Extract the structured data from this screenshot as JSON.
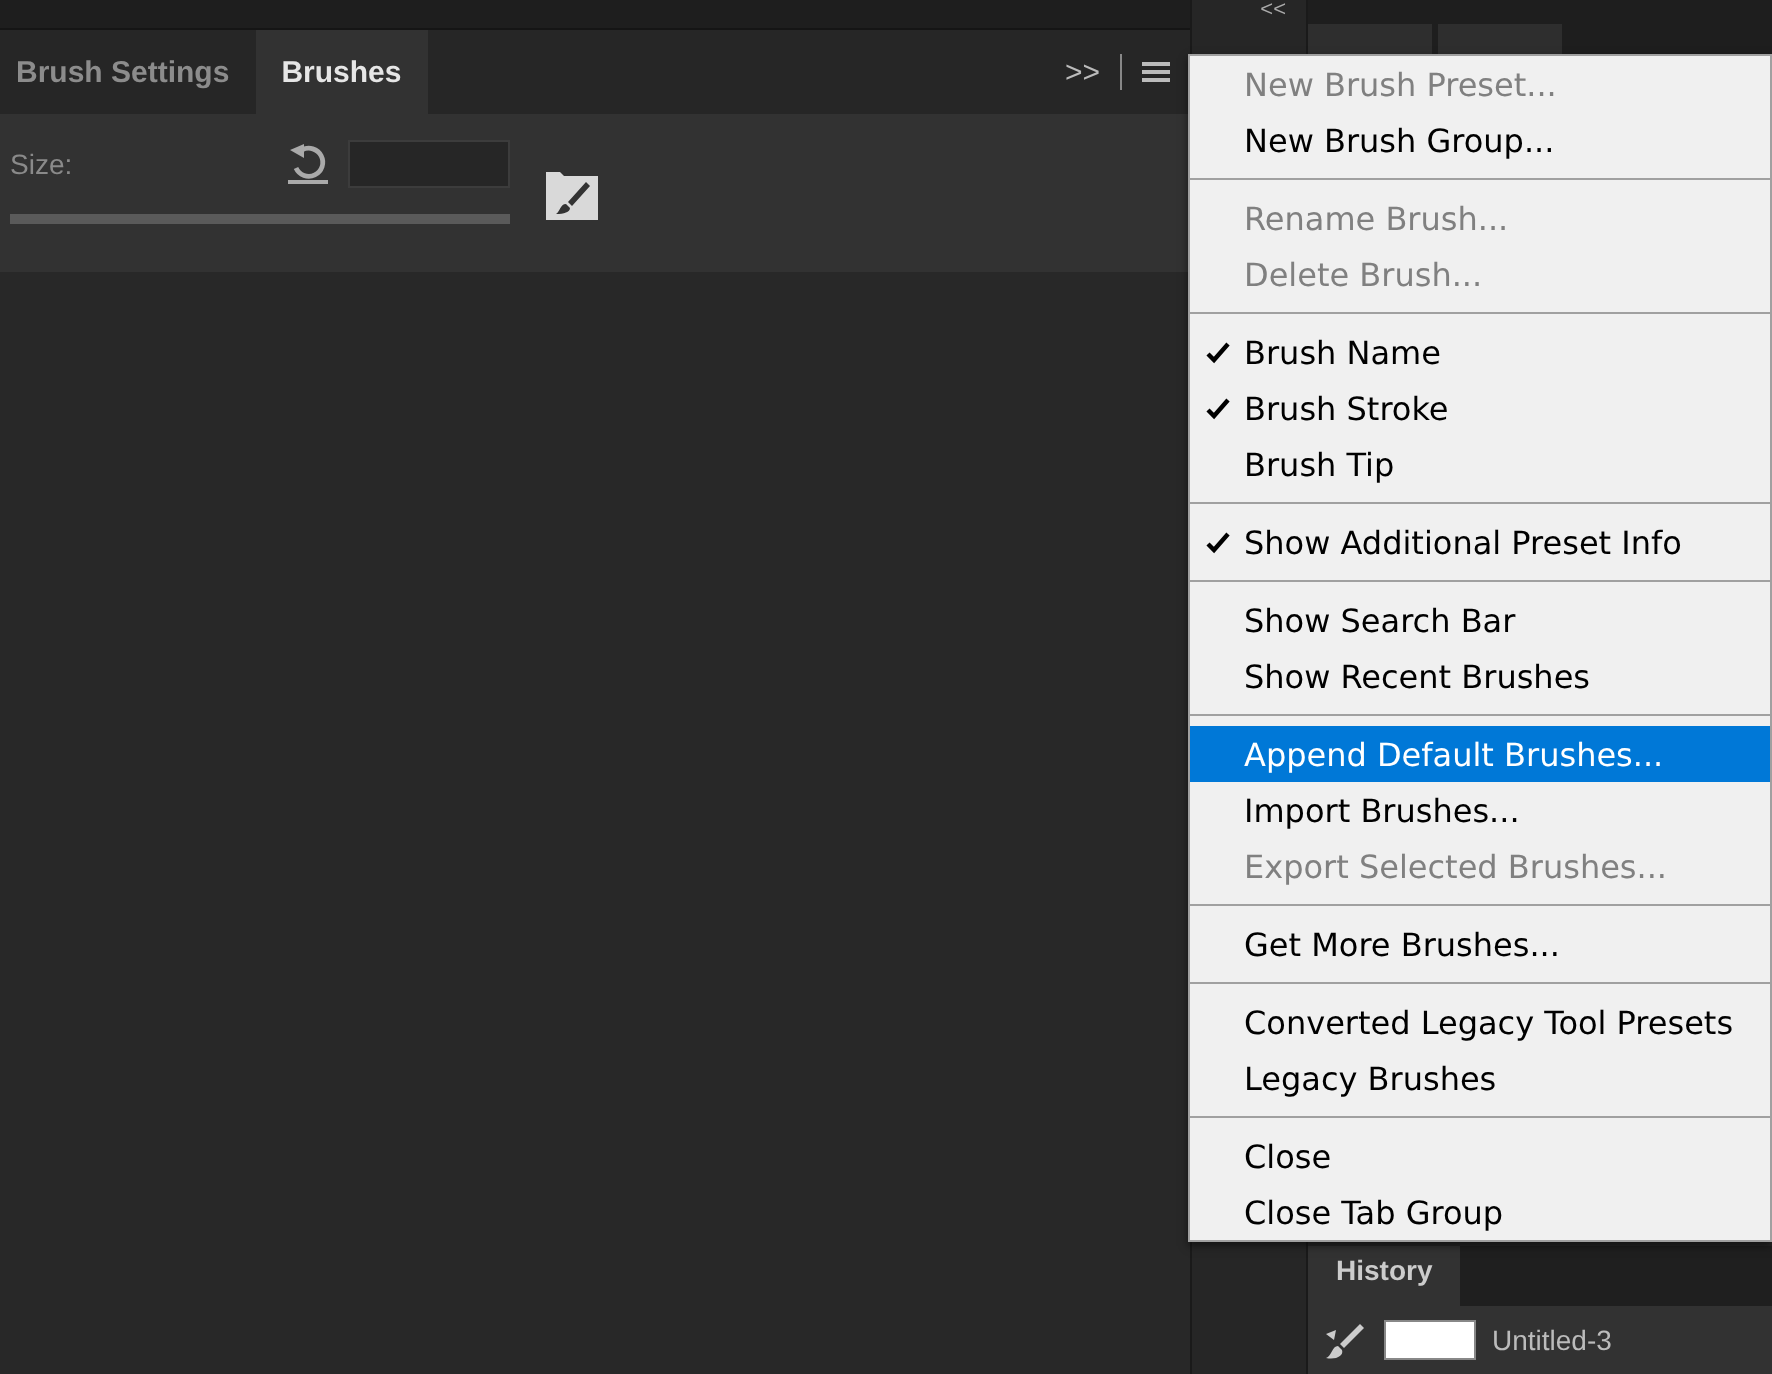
{
  "panel": {
    "tabs": [
      {
        "label": "Brush Settings",
        "selected": false
      },
      {
        "label": "Brushes",
        "selected": true
      }
    ],
    "expand_label": ">>",
    "size_label": "Size:",
    "size_slider": {
      "level": 1
    }
  },
  "dock": {
    "collapse_label": "<<",
    "history_tab": "History",
    "history_item": "Untitled-3"
  },
  "menu": {
    "groups": [
      [
        {
          "label": "New Brush Preset...",
          "disabled": true,
          "checked": false,
          "selected": false
        },
        {
          "label": "New Brush Group...",
          "disabled": false,
          "checked": false,
          "selected": false
        }
      ],
      [
        {
          "label": "Rename Brush...",
          "disabled": true,
          "checked": false,
          "selected": false
        },
        {
          "label": "Delete Brush...",
          "disabled": true,
          "checked": false,
          "selected": false
        }
      ],
      [
        {
          "label": "Brush Name",
          "disabled": false,
          "checked": true,
          "selected": false
        },
        {
          "label": "Brush Stroke",
          "disabled": false,
          "checked": true,
          "selected": false
        },
        {
          "label": "Brush Tip",
          "disabled": false,
          "checked": false,
          "selected": false
        }
      ],
      [
        {
          "label": "Show Additional Preset Info",
          "disabled": false,
          "checked": true,
          "selected": false
        }
      ],
      [
        {
          "label": "Show Search Bar",
          "disabled": false,
          "checked": false,
          "selected": false
        },
        {
          "label": "Show Recent Brushes",
          "disabled": false,
          "checked": false,
          "selected": false
        }
      ],
      [
        {
          "label": "Append Default Brushes...",
          "disabled": false,
          "checked": false,
          "selected": true
        },
        {
          "label": "Import Brushes...",
          "disabled": false,
          "checked": false,
          "selected": false
        },
        {
          "label": "Export Selected Brushes...",
          "disabled": true,
          "checked": false,
          "selected": false
        }
      ],
      [
        {
          "label": "Get More Brushes...",
          "disabled": false,
          "checked": false,
          "selected": false
        }
      ],
      [
        {
          "label": "Converted Legacy Tool Presets",
          "disabled": false,
          "checked": false,
          "selected": false
        },
        {
          "label": "Legacy Brushes",
          "disabled": false,
          "checked": false,
          "selected": false
        }
      ],
      [
        {
          "label": "Close",
          "disabled": false,
          "checked": false,
          "selected": false
        },
        {
          "label": "Close Tab Group",
          "disabled": false,
          "checked": false,
          "selected": false
        }
      ]
    ]
  }
}
